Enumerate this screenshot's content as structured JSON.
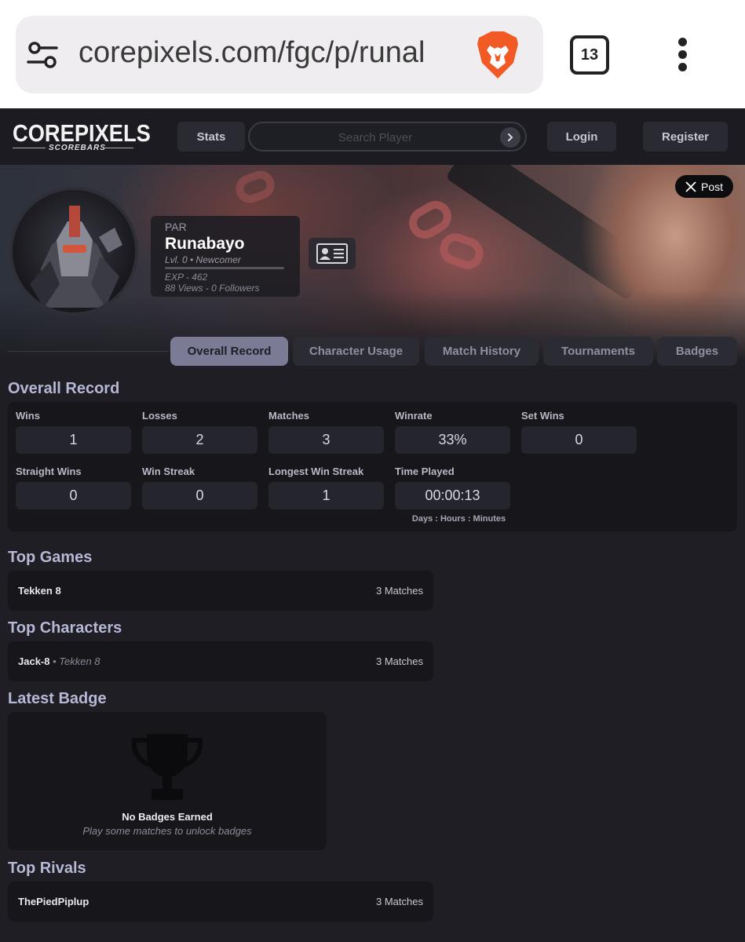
{
  "browser": {
    "url": "corepixels.com/fgc/p/runal",
    "tab_count": "13"
  },
  "nav": {
    "logo": "COREPIXELS",
    "logo_sub": "SCOREBARS",
    "stats": "Stats",
    "search_placeholder": "Search Player",
    "login": "Login",
    "register": "Register"
  },
  "banner": {
    "post_button": "Post"
  },
  "profile": {
    "team": "PAR",
    "name": "Runabayo",
    "level": "Lvl. 0 • Newcomer",
    "exp": "EXP - 462",
    "views": "88 Views - 0 Followers"
  },
  "tabs": [
    "Overall Record",
    "Character Usage",
    "Match History",
    "Tournaments",
    "Badges"
  ],
  "overall_record": {
    "heading": "Overall Record",
    "stats": [
      {
        "label": "Wins",
        "value": "1"
      },
      {
        "label": "Losses",
        "value": "2"
      },
      {
        "label": "Matches",
        "value": "3"
      },
      {
        "label": "Winrate",
        "value": "33%"
      },
      {
        "label": "Set Wins",
        "value": "0"
      },
      {
        "label": "Straight Wins",
        "value": "0"
      },
      {
        "label": "Win Streak",
        "value": "0"
      },
      {
        "label": "Longest Win Streak",
        "value": "1"
      },
      {
        "label": "Time Played",
        "value": "00:00:13"
      }
    ],
    "time_note": "Days : Hours : Minutes"
  },
  "top_games": {
    "heading": "Top Games",
    "items": [
      {
        "name": "Tekken 8",
        "count": "3 Matches"
      }
    ]
  },
  "top_characters": {
    "heading": "Top Characters",
    "items": [
      {
        "name": "Jack-8",
        "game": " • Tekken 8",
        "count": "3 Matches"
      }
    ]
  },
  "latest_badge": {
    "heading": "Latest Badge",
    "title": "No Badges Earned",
    "subtitle": "Play some matches to unlock badges"
  },
  "top_rivals": {
    "heading": "Top Rivals",
    "items": [
      {
        "name": "ThePiedPiplup",
        "count": "3 Matches"
      }
    ]
  }
}
